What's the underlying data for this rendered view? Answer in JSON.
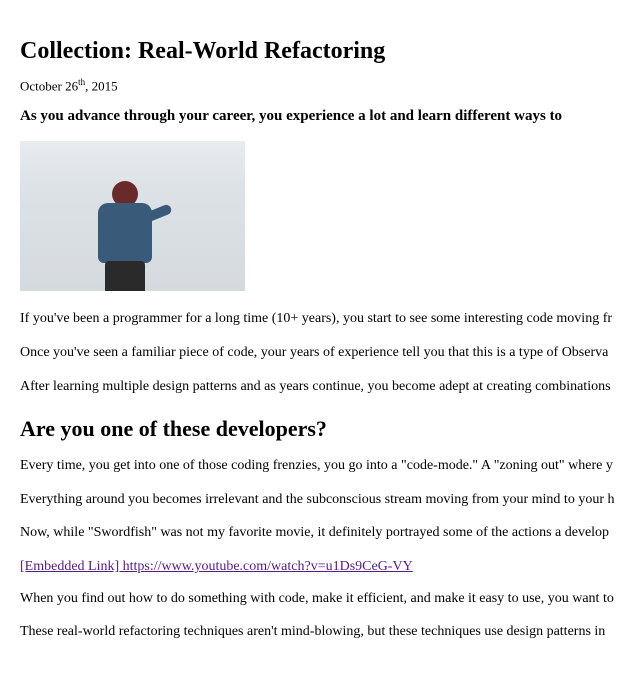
{
  "title": "Collection: Real-World Refactoring",
  "date": {
    "prefix": "October 26",
    "ordinal": "th",
    "suffix": ", 2015"
  },
  "subtitle": "As you advance through your career, you experience a lot and learn different ways to",
  "paragraphs": {
    "p1": "If you've been a programmer for a long time (10+ years), you start to see some interesting code moving fr",
    "p2": "Once you've seen a familiar piece of code, your years of experience tell you that this is a type of Observa",
    "p3": "After learning multiple design patterns and as years continue, you become adept at creating combinations"
  },
  "heading2": "Are you one of these developers?",
  "paragraphs2": {
    "p4": "Every time, you get into one of those coding frenzies, you go into a \"code-mode.\" A \"zoning out\" where y",
    "p5": "Everything around you becomes irrelevant and the subconscious stream moving from your mind to your h",
    "p6": "Now, while \"Swordfish\" was not my favorite movie, it definitely portrayed some of the actions a develop"
  },
  "embedded_link": {
    "label": "[Embedded Link] https://www.youtube.com/watch?v=u1Ds9CeG-VY"
  },
  "paragraphs3": {
    "p7": "When you find out how to do something with code, make it efficient, and make it easy to use, you want to",
    "p8": "These real-world refactoring techniques aren't mind-blowing, but these techniques use design patterns in"
  }
}
